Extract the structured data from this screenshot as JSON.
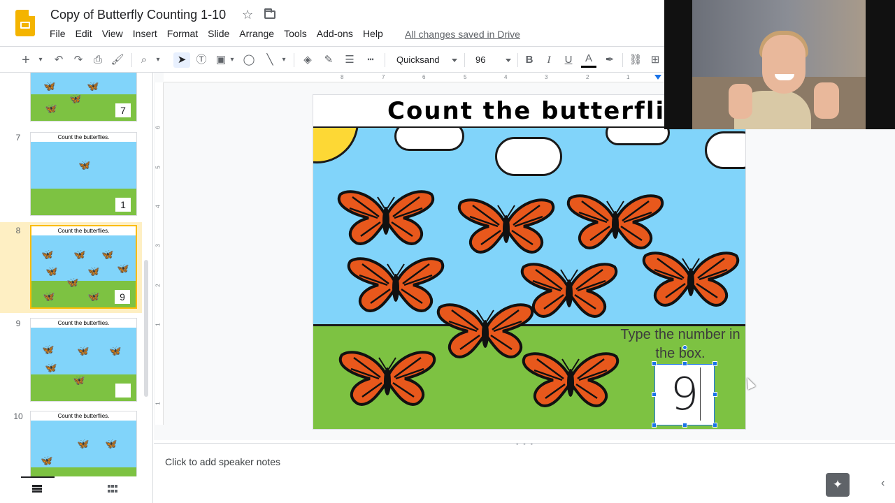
{
  "app": {
    "title": "Copy of Butterfly Counting 1-10",
    "saved_status": "All changes saved in Drive",
    "menu": [
      "File",
      "Edit",
      "View",
      "Insert",
      "Format",
      "Slide",
      "Arrange",
      "Tools",
      "Add-ons",
      "Help"
    ]
  },
  "toolbar": {
    "font": "Quicksand",
    "font_size": "96",
    "icons": [
      "new-slide-icon",
      "undo-icon",
      "redo-icon",
      "print-icon",
      "paint-format-icon",
      "zoom-icon",
      "select-icon",
      "text-box-icon",
      "image-icon",
      "shape-icon",
      "line-icon",
      "fill-color-icon",
      "border-color-icon",
      "border-weight-icon",
      "border-dash-icon",
      "bold-icon",
      "italic-icon",
      "underline-icon",
      "text-color-icon",
      "highlight-icon",
      "link-icon",
      "comment-icon"
    ]
  },
  "ruler": {
    "top": [
      "8",
      "7",
      "6",
      "5",
      "4",
      "3",
      "2",
      "1"
    ],
    "left": [
      "6",
      "5",
      "4",
      "3",
      "2",
      "1",
      "1"
    ]
  },
  "filmstrip": {
    "slides": [
      {
        "number": "",
        "title": "",
        "answer": "7",
        "active": false
      },
      {
        "number": "7",
        "title": "Count the butterflies.",
        "answer": "1",
        "active": false
      },
      {
        "number": "8",
        "title": "Count the butterflies.",
        "answer": "9",
        "active": true
      },
      {
        "number": "9",
        "title": "Count the butterflies.",
        "answer": "",
        "active": false
      },
      {
        "number": "10",
        "title": "Count the butterflies.",
        "answer": "",
        "active": false
      }
    ]
  },
  "slide": {
    "title": "Count the butterflies",
    "hint": "Type the number in the box.",
    "answer": "9",
    "butterfly_count": 9
  },
  "notes": {
    "placeholder": "Click to add speaker notes"
  },
  "colors": {
    "sky": "#81d4fa",
    "grass": "#7dc242",
    "butterfly": "#e8581c",
    "selection": "#1a73e8",
    "active_slide": "#fbbc04"
  }
}
